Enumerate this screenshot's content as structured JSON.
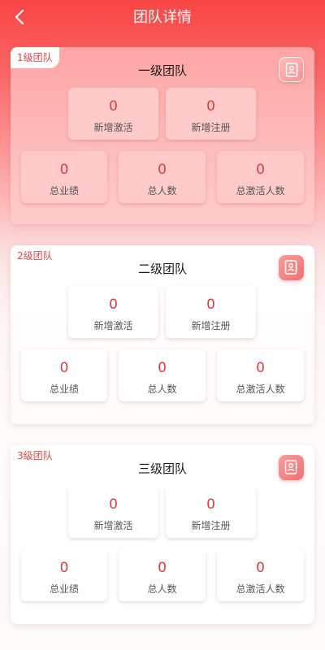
{
  "header": {
    "title": "团队详情"
  },
  "teams": [
    {
      "tag": "1级团队",
      "title": "一级团队",
      "stats": [
        {
          "value": "0",
          "label": "新增激活"
        },
        {
          "value": "0",
          "label": "新增注册"
        },
        {
          "value": "0",
          "label": "总业绩"
        },
        {
          "value": "0",
          "label": "总人数"
        },
        {
          "value": "0",
          "label": "总激活人数"
        }
      ]
    },
    {
      "tag": "2级团队",
      "title": "二级团队",
      "stats": [
        {
          "value": "0",
          "label": "新增激活"
        },
        {
          "value": "0",
          "label": "新增注册"
        },
        {
          "value": "0",
          "label": "总业绩"
        },
        {
          "value": "0",
          "label": "总人数"
        },
        {
          "value": "0",
          "label": "总激活人数"
        }
      ]
    },
    {
      "tag": "3级团队",
      "title": "三级团队",
      "stats": [
        {
          "value": "0",
          "label": "新增激活"
        },
        {
          "value": "0",
          "label": "新增注册"
        },
        {
          "value": "0",
          "label": "总业绩"
        },
        {
          "value": "0",
          "label": "总人数"
        },
        {
          "value": "0",
          "label": "总激活人数"
        }
      ]
    }
  ],
  "icons": {
    "back": "chevron-left-icon",
    "contact": "contact-card-icon"
  },
  "colors": {
    "accent": "#f84545",
    "value": "#e03c3c",
    "tag": "#e04848"
  }
}
